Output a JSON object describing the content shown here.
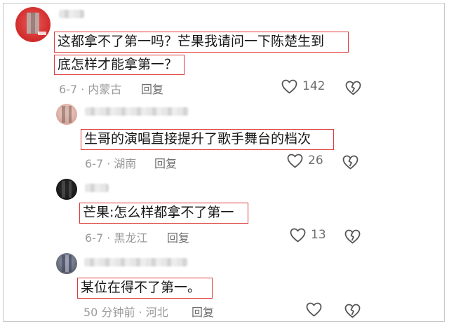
{
  "comments": [
    {
      "text_line1": "这都拿不了第一吗？芒果我请问一下陈楚生到",
      "text_line2": "底怎样才能拿第一？",
      "date": "6-7",
      "location": "内蒙古",
      "reply_label": "回复",
      "likes": "142"
    },
    {
      "text": "生哥的演唱直接提升了歌手舞台的档次",
      "date": "6-7",
      "location": "湖南",
      "reply_label": "回复",
      "likes": "26"
    },
    {
      "text": "芒果:怎么样都拿不了第一",
      "date": "6-7",
      "location": "黑龙江",
      "reply_label": "回复",
      "likes": "13"
    },
    {
      "text": "某位在得不了第一。",
      "date": "50 分钟前",
      "location": "河北",
      "reply_label": "回复",
      "likes": ""
    }
  ],
  "meta_separator": "·",
  "colors": {
    "highlight_box": "#e03a3a",
    "meta_text": "#9a9a9a",
    "icon_stroke": "#555555"
  },
  "icons": {
    "like": "heart-outline-icon",
    "dislike": "broken-heart-icon"
  }
}
